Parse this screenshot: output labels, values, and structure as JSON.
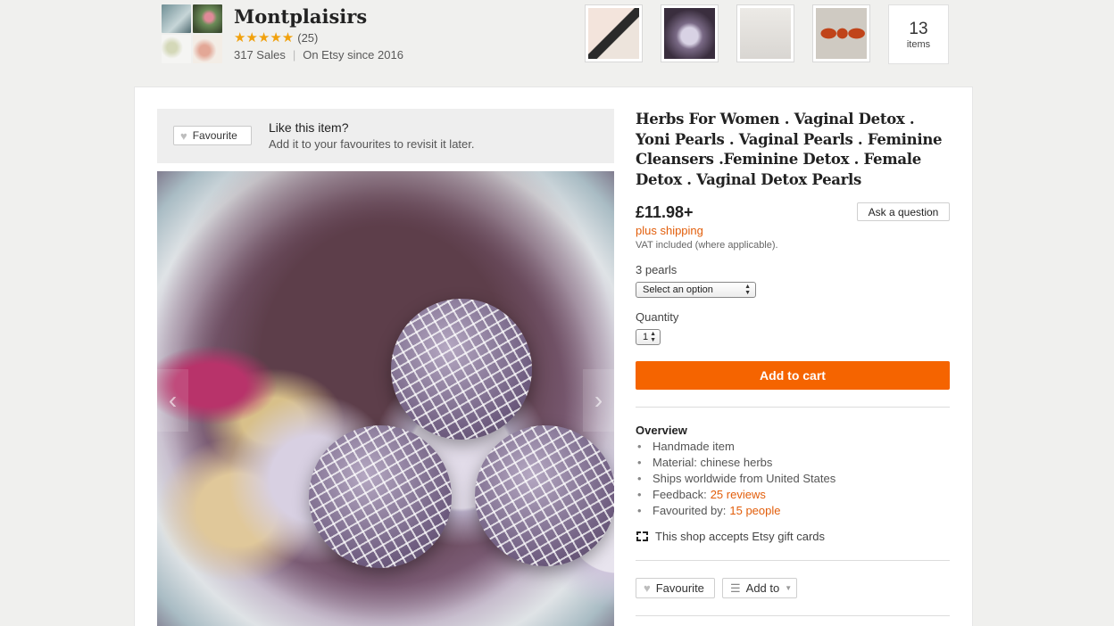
{
  "shop": {
    "name": "Montplaisirs",
    "stars": "★★★★★",
    "review_count": "(25)",
    "sales": "317 Sales",
    "since": "On Etsy since 2016",
    "items_count": "13",
    "items_label": "items"
  },
  "favourite_banner": {
    "button_label": "Favourite",
    "title": "Like this item?",
    "subtitle": "Add it to your favourites to revisit it later."
  },
  "listing": {
    "title": "Herbs For Women . Vaginal Detox . Yoni Pearls . Vaginal Pearls . Feminine Cleansers .Feminine Detox . Female Detox . Vaginal Detox Pearls",
    "price": "£11.98+",
    "ask_button": "Ask a question",
    "shipping": "plus shipping",
    "vat": "VAT included (where applicable).",
    "variation_label": "3 pearls",
    "variation_selected": "Select an option",
    "quantity_label": "Quantity",
    "quantity_value": "1",
    "cart_button": "Add to cart"
  },
  "overview": {
    "title": "Overview",
    "items": {
      "handmade": "Handmade item",
      "material": "Material: chinese herbs",
      "ships": "Ships worldwide from United States",
      "feedback_label": "Feedback:",
      "feedback_link": "25 reviews",
      "favourited_label": "Favourited by:",
      "favourited_link": "15 people"
    },
    "gift_cards": "This shop accepts Etsy gift cards"
  },
  "actions": {
    "favourite": "Favourite",
    "add_to": "Add to"
  },
  "colors": {
    "accent": "#f56400",
    "link": "#e25e0b",
    "star": "#f1a10d"
  }
}
